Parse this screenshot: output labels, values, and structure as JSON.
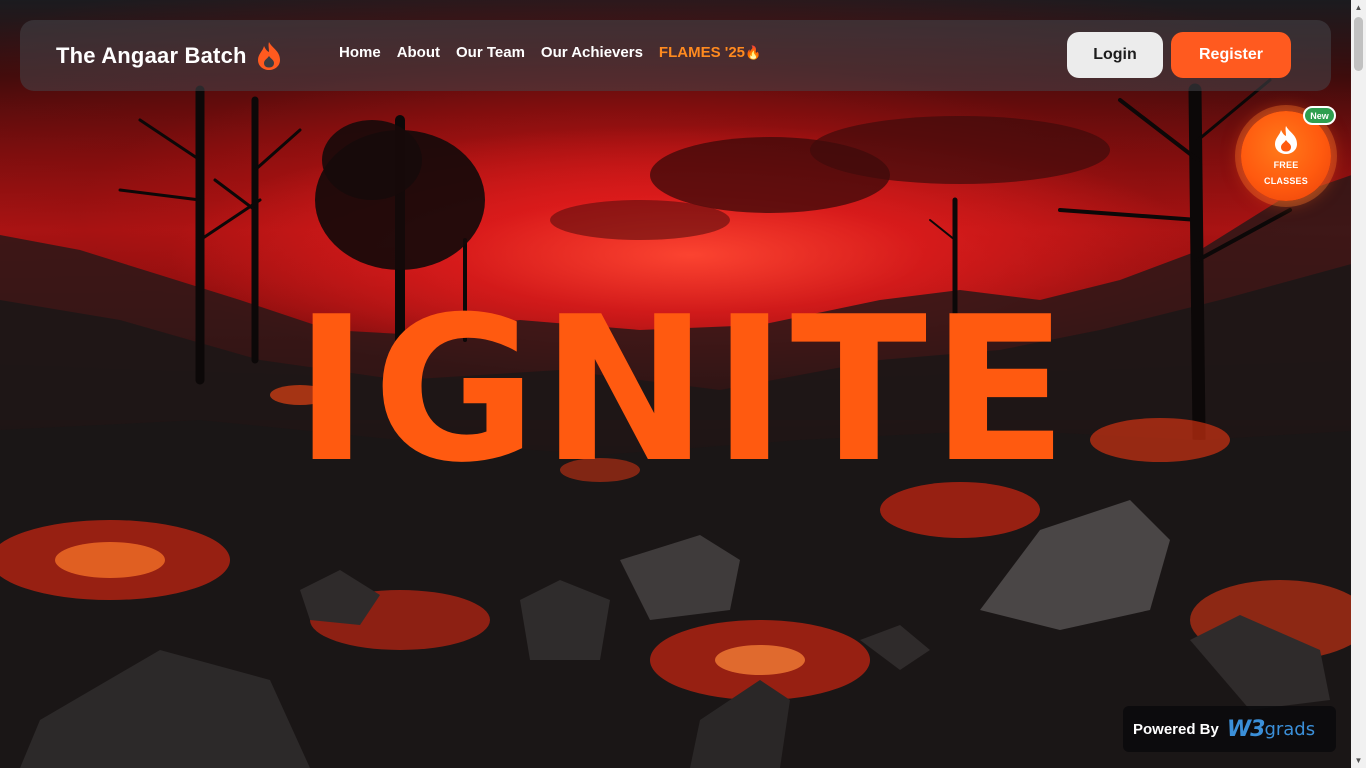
{
  "navbar": {
    "brand_name": "The Angaar Batch",
    "brand_icon": "flame-icon",
    "links": [
      {
        "label": "Home"
      },
      {
        "label": "About"
      },
      {
        "label": "Our Team"
      },
      {
        "label": "Our Achievers"
      },
      {
        "label": "FLAMES '25",
        "emoji": "🔥"
      }
    ],
    "login_label": "Login",
    "register_label": "Register"
  },
  "badge": {
    "new_label": "New",
    "line1": "FREE",
    "line2": "CLASSES",
    "icon": "flame-icon"
  },
  "hero": {
    "title": "IGNITE"
  },
  "footer": {
    "powered_by": "Powered By",
    "brand_mark": "W3",
    "brand_suffix": "grads"
  },
  "colors": {
    "accent": "#ff5a1f",
    "accent_text": "#ff8a1f",
    "badge_green": "#2e9e4f",
    "w3_blue": "#3b8fd8"
  }
}
